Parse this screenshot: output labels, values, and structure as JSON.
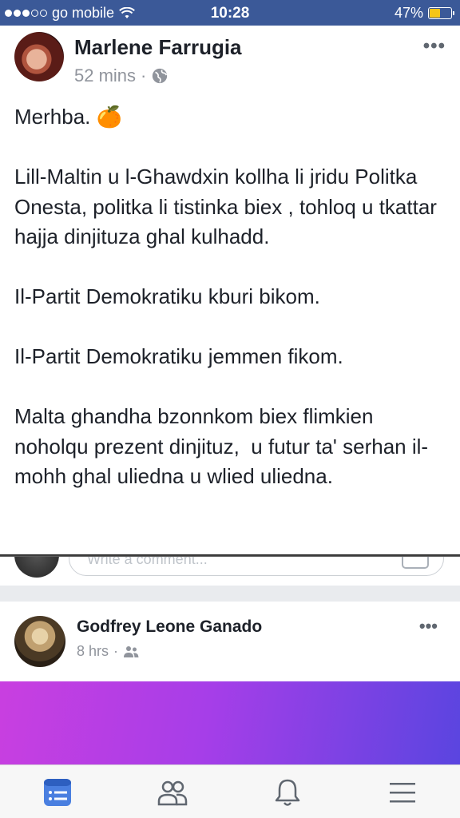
{
  "status_bar": {
    "carrier": "go mobile",
    "time": "10:28",
    "battery_percent": "47%",
    "battery_level": 0.47,
    "signal_bars_filled": 3,
    "signal_bars_total": 5
  },
  "post": {
    "author": "Marlene Farrugia",
    "time": "52 mins",
    "separator": "·",
    "audience_icon": "globe-icon",
    "more_label": "•••",
    "body": "Merhba. 🍊\n\nLill-Maltin u l-Ghawdxin kollha li jridu Politka Onesta, politka li tistinka biex , tohloq u tkattar  hajja dinjituza ghal kulhadd.\n\nIl-Partit Demokratiku kburi bikom.\n\nIl-Partit Demokratiku jemmen fikom.\n\nMalta ghandha bzonnkom biex flimkien noholqu prezent dinjituz,  u futur ta' serhan il-mohh ghal uliedna u wlied uliedna."
  },
  "comment": {
    "placeholder": "Write a comment..."
  },
  "post2": {
    "author": "Godfrey Leone Ganado",
    "time": "8 hrs",
    "separator": "·",
    "audience_icon": "friends-icon",
    "more_label": "•••"
  },
  "colors": {
    "header_blue": "#3b5998",
    "accent_blue": "#4a7fe0",
    "banner_start": "#c93fe0",
    "banner_end": "#5a45e0"
  },
  "tabs": [
    {
      "icon": "news-feed-icon",
      "active": true
    },
    {
      "icon": "friends-icon",
      "active": false
    },
    {
      "icon": "bell-icon",
      "active": false
    },
    {
      "icon": "menu-icon",
      "active": false
    }
  ]
}
